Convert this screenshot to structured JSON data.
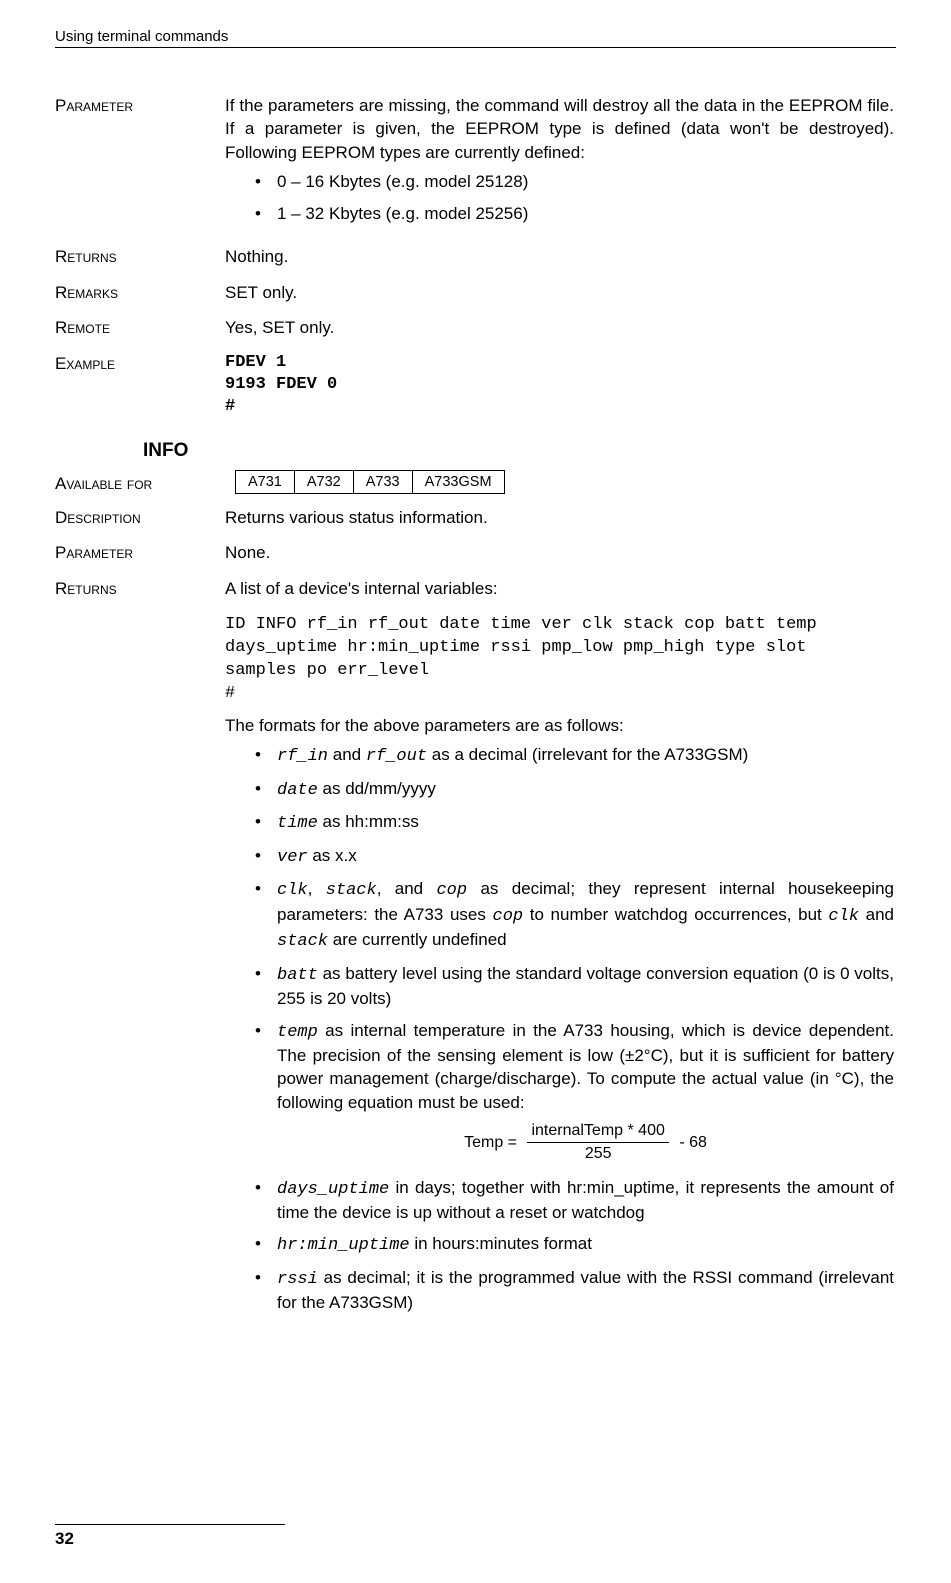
{
  "header": {
    "running_title": "Using terminal commands"
  },
  "fdev": {
    "parameter_label": "Parameter",
    "parameter_text": "If the parameters are missing, the command will destroy all the data in the EEPROM file. If a parameter is given, the EEPROM type is defined (data won't be destroyed). Following EEPROM types are currently defined:",
    "param_items": [
      "0 – 16 Kbytes (e.g. model 25128)",
      "1 – 32 Kbytes (e.g. model 25256)"
    ],
    "returns_label": "Returns",
    "returns_text": "Nothing.",
    "remarks_label": "Remarks",
    "remarks_text": "SET only.",
    "remote_label": "Remote",
    "remote_text": "Yes, SET only.",
    "example_label": "Example",
    "example_lines": [
      "FDEV 1",
      "9193 FDEV 0",
      "#"
    ]
  },
  "info": {
    "title": "INFO",
    "available_label": "Available for",
    "available_models": [
      "A731",
      "A732",
      "A733",
      "A733GSM"
    ],
    "description_label": "Description",
    "description_text": "Returns various status information.",
    "parameter_label": "Parameter",
    "parameter_text": "None.",
    "returns_label": "Returns",
    "returns_text": "A list of a device's internal variables:",
    "returns_code": "ID INFO rf_in rf_out date time ver clk stack cop batt temp\ndays_uptime hr:min_uptime rssi pmp_low pmp_high type slot\nsamples po err_level\n#",
    "formats_intro": "The formats for the above parameters are as follows:",
    "format_items": {
      "rf": {
        "code1": "rf_in",
        "mid": " and ",
        "code2": "rf_out",
        "tail": " as a decimal (irrelevant for the A733GSM)"
      },
      "date": {
        "code": "date",
        "tail": " as dd/mm/yyyy"
      },
      "time": {
        "code": "time",
        "tail": " as hh:mm:ss"
      },
      "ver": {
        "code": "ver",
        "tail": " as x.x"
      },
      "clk": {
        "c1": "clk",
        "s1": ", ",
        "c2": "stack",
        "s2": ", and ",
        "c3": "cop",
        "s3": " as decimal; they represent internal housekeeping parameters: the A733 uses  ",
        "c4": "cop",
        "s4": " to number watchdog occurrences, but ",
        "c5": "clk",
        "s5": " and ",
        "c6": "stack",
        "s6": " are currently undefined"
      },
      "batt": {
        "code": "batt",
        "tail": " as battery level using the standard voltage conversion equation (0 is 0 volts, 255 is 20 volts)"
      },
      "temp": {
        "code": "temp",
        "tail": " as internal temperature in the A733 housing, which is device dependent. The precision of the sensing element is low (±2°C), but it is sufficient for battery power management (charge/discharge). To compute the actual value (in °C), the following equation must be used:"
      },
      "equation": {
        "lhs": "Temp = ",
        "num": "internalTemp * 400",
        "den": "255",
        "rhs": " - 68"
      },
      "days": {
        "code": "days_uptime",
        "tail": " in days; together with hr:min_uptime, it represents the amount of time the device is up without a reset or watchdog"
      },
      "hrmin": {
        "code": "hr:min_uptime",
        "tail": " in hours:minutes format"
      },
      "rssi": {
        "code": "rssi",
        "tail": " as decimal; it is the programmed value with the RSSI command (irrelevant for the A733GSM)"
      }
    }
  },
  "footer": {
    "page": "32"
  }
}
